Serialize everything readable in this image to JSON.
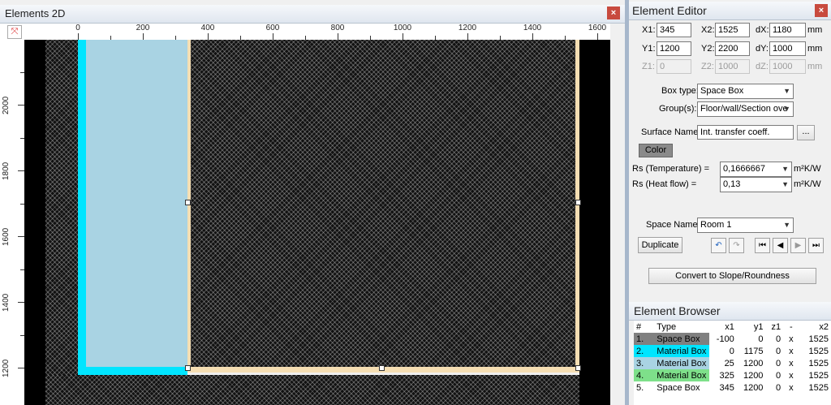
{
  "left_window": {
    "title": "Elements 2D",
    "close_label": "×",
    "fit_icon": "fit-view-icon",
    "hruler_ticks": [
      "0",
      "200",
      "400",
      "600",
      "800",
      "1000",
      "1200",
      "1400",
      "1600"
    ],
    "vruler_ticks": [
      "2000",
      "1800",
      "1600",
      "1400",
      "1200"
    ]
  },
  "editor": {
    "title": "Element Editor",
    "close_label": "×",
    "x1_label": "X1:",
    "x1": "345",
    "x2_label": "X2:",
    "x2": "1525",
    "dx_label": "dX:",
    "dx": "1180",
    "y1_label": "Y1:",
    "y1": "1200",
    "y2_label": "Y2:",
    "y2": "2200",
    "dy_label": "dY:",
    "dy": "1000",
    "z1_label": "Z1:",
    "z1": "0",
    "z2_label": "Z2:",
    "z2": "1000",
    "dz_label": "dZ:",
    "dz": "1000",
    "unit_mm": "mm",
    "box_type_label": "Box type:",
    "box_type": "Space Box",
    "groups_label": "Group(s):",
    "groups": "Floor/wall/Section ove",
    "surface_name_label": "Surface Name:",
    "surface_name": "Int. transfer coeff.",
    "browse_label": "...",
    "color_label": "Color",
    "rs_temp_label": "Rs (Temperature) =",
    "rs_temp": "0,1666667",
    "rs_temp_unit": "m²K/W",
    "rs_heat_label": "Rs (Heat flow) =",
    "rs_heat": "0,13",
    "rs_heat_unit": "m²K/W",
    "space_name_label": "Space Name:",
    "space_name": "Room 1",
    "duplicate_label": "Duplicate",
    "convert_label": "Convert to Slope/Roundness"
  },
  "browser": {
    "title": "Element Browser",
    "columns": [
      "#",
      "Type",
      "x1",
      "y1",
      "z1",
      "-",
      "x2"
    ],
    "rows": [
      {
        "num": "1.",
        "type": "Space Box",
        "x1": "-100",
        "y1": "0",
        "z1": "0",
        "dash": "x",
        "x2": "1525",
        "color": "#808080"
      },
      {
        "num": "2.",
        "type": "Material Box",
        "x1": "0",
        "y1": "1175",
        "z1": "0",
        "dash": "x",
        "x2": "1525",
        "color": "#00e5ff"
      },
      {
        "num": "3.",
        "type": "Material Box",
        "x1": "25",
        "y1": "1200",
        "z1": "0",
        "dash": "x",
        "x2": "1525",
        "color": "#a9d3e3"
      },
      {
        "num": "4.",
        "type": "Material Box",
        "x1": "325",
        "y1": "1200",
        "z1": "0",
        "dash": "x",
        "x2": "1525",
        "color": "#7ee08a"
      },
      {
        "num": "5.",
        "type": "Space Box",
        "x1": "345",
        "y1": "1200",
        "z1": "0",
        "dash": "x",
        "x2": "1525",
        "color": ""
      }
    ]
  }
}
